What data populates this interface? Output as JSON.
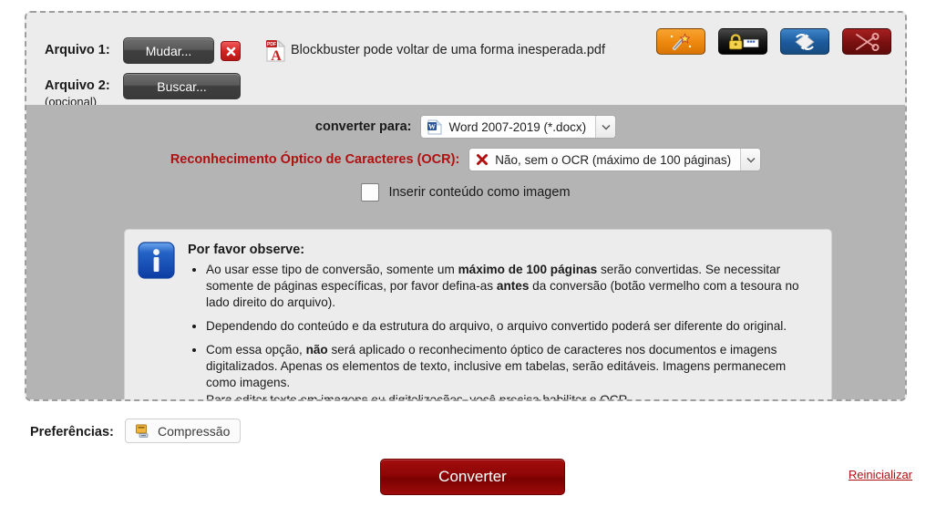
{
  "file_section": {
    "file1_label": "Arquivo 1:",
    "file1_button": "Mudar...",
    "delete_icon": "close-x-icon",
    "file1_name": "Blockbuster pode voltar de uma forma inesperada.pdf",
    "file2_label": "Arquivo 2:",
    "file2_sub": "(opcional)",
    "file2_button": "Buscar..."
  },
  "tools": [
    {
      "name": "magic-wand-icon",
      "title": "wand",
      "color": "#ef8a10"
    },
    {
      "name": "password-lock-icon",
      "title": "lock",
      "color": "#000000"
    },
    {
      "name": "rotate-pages-icon",
      "title": "rotate",
      "color": "#1d5c9e"
    },
    {
      "name": "scissors-split-icon",
      "title": "scissors",
      "color": "#7e1111"
    }
  ],
  "options": {
    "convert_to_label": "converter para:",
    "convert_to_value": "Word 2007-2019 (*.docx)",
    "convert_to_icon": "word-doc-icon",
    "ocr_label": "Reconhecimento Óptico de Caracteres (OCR):",
    "ocr_value": "Não, sem o OCR (máximo de 100 páginas)",
    "ocr_icon": "red-x-icon",
    "insert_as_image_label": "Inserir conteúdo como imagem",
    "insert_as_image_checked": false
  },
  "notice": {
    "icon": "info-icon",
    "title": "Por favor observe:",
    "bullets": [
      {
        "parts": [
          {
            "t": "Ao usar esse tipo de conversão, somente um ",
            "b": false
          },
          {
            "t": "máximo de 100 páginas",
            "b": true
          },
          {
            "t": " serão convertidas. Se necessitar somente de páginas específicas, por favor defina-as ",
            "b": false
          },
          {
            "t": "antes",
            "b": true
          },
          {
            "t": " da conversão (botão vermelho com a tesoura no lado direito do arquivo).",
            "b": false
          }
        ]
      },
      {
        "parts": [
          {
            "t": "Dependendo do conteúdo e da estrutura do arquivo, o arquivo convertido poderá ser diferente do original.",
            "b": false
          }
        ]
      },
      {
        "parts": [
          {
            "t": "Com essa opção, ",
            "b": false
          },
          {
            "t": "não",
            "b": true
          },
          {
            "t": " será aplicado o reconhecimento óptico de caracteres nos documentos e imagens digitalizados. Apenas os elementos de texto, inclusive em tabelas, serão editáveis. Imagens permanecem como imagens.",
            "b": false
          },
          {
            "t": "\nPara editar texto em imagens ou digitalizações, você precisa habilitar o OCR.",
            "b": false
          }
        ]
      }
    ]
  },
  "footer": {
    "prefs_label": "Preferências:",
    "compression_button": "Compressão",
    "compression_icon": "compression-icon",
    "convert_button": "Converter",
    "reset_link": "Reinicializar"
  }
}
